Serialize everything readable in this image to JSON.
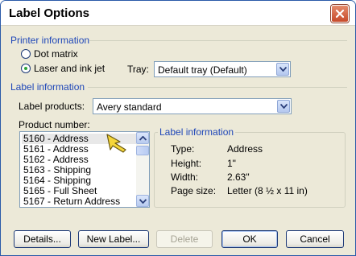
{
  "window": {
    "title": "Label Options"
  },
  "printer_info": {
    "heading": "Printer information",
    "options": [
      {
        "label": "Dot matrix",
        "selected": false
      },
      {
        "label": "Laser and ink jet",
        "selected": true
      }
    ],
    "tray_label": "Tray:",
    "tray_value": "Default tray (Default)"
  },
  "label_info": {
    "heading": "Label information",
    "products_label": "Label products:",
    "products_value": "Avery standard"
  },
  "product_number": {
    "label": "Product number:",
    "items": [
      "5160 - Address",
      "5161 - Address",
      "5162 - Address",
      "5163 - Shipping",
      "5164 - Shipping",
      "5165 - Full Sheet",
      "5167 - Return Address"
    ],
    "selected_index": 0
  },
  "details": {
    "heading": "Label information",
    "rows": [
      {
        "key": "Type:",
        "value": "Address"
      },
      {
        "key": "Height:",
        "value": "1\""
      },
      {
        "key": "Width:",
        "value": "2.63\""
      },
      {
        "key": "Page size:",
        "value": "Letter (8 ½ x 11 in)"
      }
    ]
  },
  "buttons": {
    "details": "Details...",
    "new_label": "New Label...",
    "delete": "Delete",
    "ok": "OK",
    "cancel": "Cancel"
  },
  "colors": {
    "accent": "#1f47b8",
    "frame": "#2a5aa8",
    "close": "#c74a2a"
  },
  "icons": [
    "close-icon",
    "dropdown-arrow-icon",
    "scroll-up-icon",
    "scroll-down-icon",
    "mouse-pointer-icon"
  ]
}
